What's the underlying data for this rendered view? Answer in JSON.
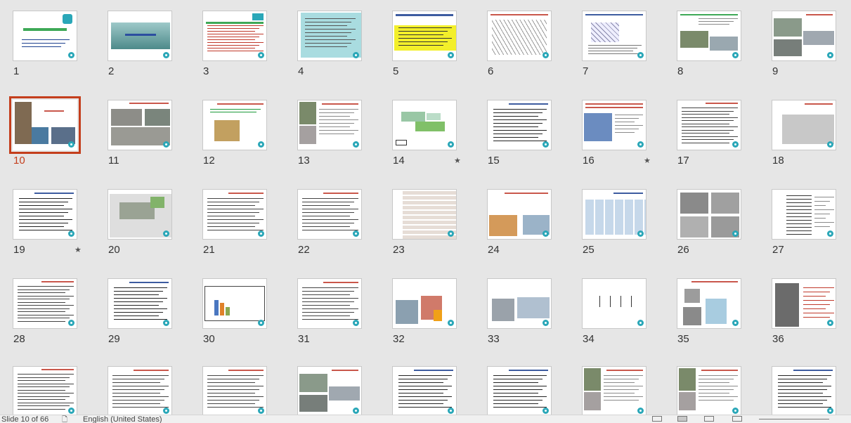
{
  "selected_slide": 10,
  "slides": [
    {
      "n": "1",
      "v": "title",
      "star": false
    },
    {
      "n": "2",
      "v": "banner",
      "star": false
    },
    {
      "n": "3",
      "v": "text_g",
      "star": false
    },
    {
      "n": "4",
      "v": "cyan",
      "star": false
    },
    {
      "n": "5",
      "v": "yellow",
      "star": false
    },
    {
      "n": "6",
      "v": "frame",
      "star": false
    },
    {
      "n": "7",
      "v": "frame2",
      "star": false
    },
    {
      "n": "8",
      "v": "text_photo",
      "star": false
    },
    {
      "n": "9",
      "v": "photos",
      "star": false
    },
    {
      "n": "10",
      "v": "photos_sel",
      "star": false
    },
    {
      "n": "11",
      "v": "photos2",
      "star": false
    },
    {
      "n": "12",
      "v": "photo_one",
      "star": false
    },
    {
      "n": "13",
      "v": "photo_text",
      "star": false
    },
    {
      "n": "14",
      "v": "diagram_green",
      "star": true
    },
    {
      "n": "15",
      "v": "text_b",
      "star": false
    },
    {
      "n": "16",
      "v": "photo_text2",
      "star": true
    },
    {
      "n": "17",
      "v": "text_dense",
      "star": false
    },
    {
      "n": "18",
      "v": "photo_right",
      "star": false
    },
    {
      "n": "19",
      "v": "text_b",
      "star": true
    },
    {
      "n": "20",
      "v": "machine",
      "star": false
    },
    {
      "n": "21",
      "v": "text_r",
      "star": false
    },
    {
      "n": "22",
      "v": "text_r",
      "star": false
    },
    {
      "n": "23",
      "v": "table",
      "star": false
    },
    {
      "n": "24",
      "v": "blocks",
      "star": false
    },
    {
      "n": "25",
      "v": "blocks2",
      "star": false
    },
    {
      "n": "26",
      "v": "photos3",
      "star": false
    },
    {
      "n": "27",
      "v": "drawing",
      "star": false
    },
    {
      "n": "28",
      "v": "text_dense",
      "star": false
    },
    {
      "n": "29",
      "v": "text_b",
      "star": false
    },
    {
      "n": "30",
      "v": "chart",
      "star": false
    },
    {
      "n": "31",
      "v": "text_r",
      "star": false
    },
    {
      "n": "32",
      "v": "pic_hand",
      "star": false
    },
    {
      "n": "33",
      "v": "pic_wall",
      "star": false
    },
    {
      "n": "34",
      "v": "arrows",
      "star": false
    },
    {
      "n": "35",
      "v": "panel",
      "star": false
    },
    {
      "n": "36",
      "v": "section",
      "star": false
    },
    {
      "n": "",
      "v": "text_dense",
      "star": false
    },
    {
      "n": "",
      "v": "text_r",
      "star": false
    },
    {
      "n": "",
      "v": "text_r",
      "star": false
    },
    {
      "n": "",
      "v": "photos",
      "star": false
    },
    {
      "n": "",
      "v": "text_b",
      "star": false
    },
    {
      "n": "",
      "v": "text_b",
      "star": false
    },
    {
      "n": "",
      "v": "photo_text",
      "star": false
    },
    {
      "n": "",
      "v": "photo_text",
      "star": false
    },
    {
      "n": "",
      "v": "text_b",
      "star": false
    }
  ],
  "status": {
    "slide_position": "Slide 10 of 66",
    "language": "English (United States)"
  },
  "colors": {
    "accent": "#c43e1c",
    "background": "#e6e6e6"
  }
}
